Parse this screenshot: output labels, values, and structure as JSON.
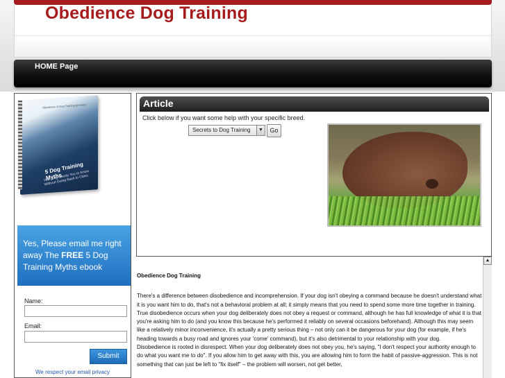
{
  "site": {
    "title": "Obedience Dog Training"
  },
  "nav": {
    "items": [
      {
        "label": "HOME Page"
      }
    ]
  },
  "sidebar": {
    "ebook": {
      "top_text": "Obedience & Dog Training presents",
      "title": "5 Dog Training Myths",
      "subtitle": "Your Dog Needs You to Know Without Going Back to Class"
    },
    "optin": {
      "text_before": "Yes, Please email me right away The ",
      "text_strong": "FREE",
      "text_after": " 5 Dog Training Myths ebook"
    },
    "form": {
      "name_label": "Name:",
      "email_label": "Email:",
      "submit_label": "Submit",
      "privacy_text": "We respect your email privacy"
    }
  },
  "article": {
    "header": "Article",
    "breed_prompt": "Click below if you want some help with your specific breed.",
    "select_value": "Secrets to Dog Training",
    "go_label": "Go"
  },
  "content": {
    "heading": "Obedience Dog Training",
    "paragraph1": "There's a difference between disobedience and incomprehension. If your dog isn't obeying a command because he doesn't understand what it is you want him to do, that's not a behavioral problem at all; it simply means that you need to spend some more time together in training. True disobedience occurs when your dog deliberately does not obey a request or command, although he has full knowledge of what it is that you're asking him to do (and you know this because he's performed it reliably on several occasions beforehand). Although this may seem like a relatively minor inconvenience, it's actually a pretty serious thing – not only can it be dangerous for your dog (for example, if he's heading towards a busy road and ignores your 'come' command), but it's also detrimental to your relationship with your dog.",
    "paragraph2": "Disobedience is rooted in disrespect. When your dog deliberately does not obey you, he's saying, \"I don't respect your authority enough to do what you want me to do\". If you allow him to get away with this, you are allowing him to form the habit of passive-aggression. This is not something that can just be left to \"fix itself\" – the problem will worsen, not get better,"
  },
  "colors": {
    "brand_red": "#a61c1c",
    "optin_blue": "#2a7fd0",
    "nav_black": "#111111"
  }
}
